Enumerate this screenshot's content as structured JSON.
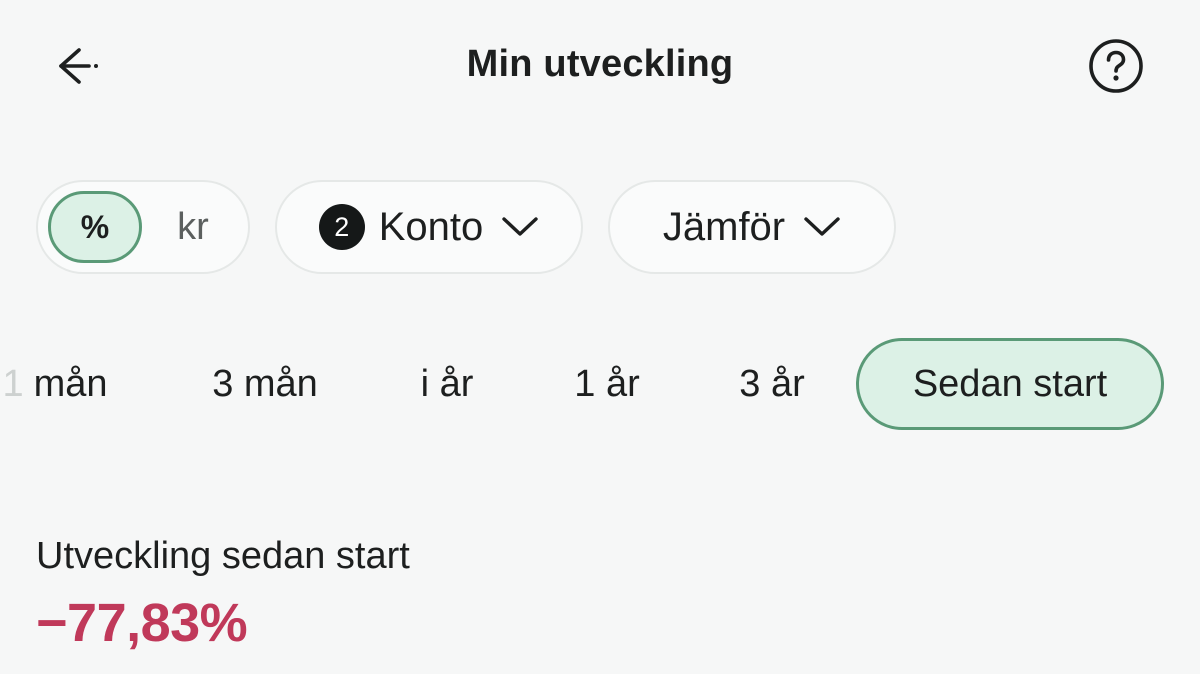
{
  "header": {
    "title": "Min utveckling"
  },
  "unit_toggle": {
    "percent_label": "%",
    "kr_label": "kr",
    "selected": "%"
  },
  "account_filter": {
    "count": "2",
    "label": "Konto"
  },
  "compare_filter": {
    "label": "Jämför"
  },
  "periods": {
    "first_partial": "1",
    "items": [
      "mån",
      "3 mån",
      "i år",
      "1 år",
      "3 år",
      "Sedan start"
    ],
    "selected": "Sedan start"
  },
  "development": {
    "label": "Utveckling sedan start",
    "value": "−77,83%"
  },
  "colors": {
    "background": "#f6f7f7",
    "selected_fill": "#dcf1e6",
    "selected_border": "#5a9a77",
    "negative": "#c0395a",
    "badge": "#151818"
  },
  "icons": {
    "back": "arrow-left-icon",
    "help": "question-circle-icon",
    "chevron": "chevron-down-icon"
  }
}
